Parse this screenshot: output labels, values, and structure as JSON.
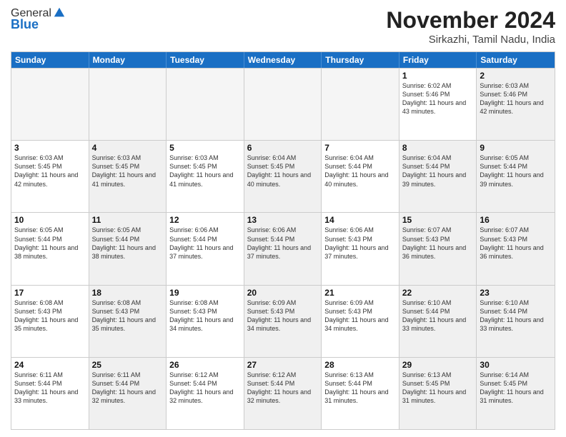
{
  "logo": {
    "general": "General",
    "blue": "Blue"
  },
  "title": "November 2024",
  "location": "Sirkazhi, Tamil Nadu, India",
  "header": {
    "days": [
      "Sunday",
      "Monday",
      "Tuesday",
      "Wednesday",
      "Thursday",
      "Friday",
      "Saturday"
    ]
  },
  "rows": [
    {
      "cells": [
        {
          "empty": true,
          "text": ""
        },
        {
          "empty": true,
          "text": ""
        },
        {
          "empty": true,
          "text": ""
        },
        {
          "empty": true,
          "text": ""
        },
        {
          "empty": true,
          "text": ""
        },
        {
          "day": "1",
          "info": "Sunrise: 6:02 AM\nSunset: 5:46 PM\nDaylight: 11 hours and 43 minutes."
        },
        {
          "day": "2",
          "shaded": true,
          "info": "Sunrise: 6:03 AM\nSunset: 5:46 PM\nDaylight: 11 hours and 42 minutes."
        }
      ]
    },
    {
      "cells": [
        {
          "day": "3",
          "info": "Sunrise: 6:03 AM\nSunset: 5:45 PM\nDaylight: 11 hours and 42 minutes."
        },
        {
          "day": "4",
          "shaded": true,
          "info": "Sunrise: 6:03 AM\nSunset: 5:45 PM\nDaylight: 11 hours and 41 minutes."
        },
        {
          "day": "5",
          "info": "Sunrise: 6:03 AM\nSunset: 5:45 PM\nDaylight: 11 hours and 41 minutes."
        },
        {
          "day": "6",
          "shaded": true,
          "info": "Sunrise: 6:04 AM\nSunset: 5:45 PM\nDaylight: 11 hours and 40 minutes."
        },
        {
          "day": "7",
          "info": "Sunrise: 6:04 AM\nSunset: 5:44 PM\nDaylight: 11 hours and 40 minutes."
        },
        {
          "day": "8",
          "shaded": true,
          "info": "Sunrise: 6:04 AM\nSunset: 5:44 PM\nDaylight: 11 hours and 39 minutes."
        },
        {
          "day": "9",
          "shaded": true,
          "info": "Sunrise: 6:05 AM\nSunset: 5:44 PM\nDaylight: 11 hours and 39 minutes."
        }
      ]
    },
    {
      "cells": [
        {
          "day": "10",
          "info": "Sunrise: 6:05 AM\nSunset: 5:44 PM\nDaylight: 11 hours and 38 minutes."
        },
        {
          "day": "11",
          "shaded": true,
          "info": "Sunrise: 6:05 AM\nSunset: 5:44 PM\nDaylight: 11 hours and 38 minutes."
        },
        {
          "day": "12",
          "info": "Sunrise: 6:06 AM\nSunset: 5:44 PM\nDaylight: 11 hours and 37 minutes."
        },
        {
          "day": "13",
          "shaded": true,
          "info": "Sunrise: 6:06 AM\nSunset: 5:44 PM\nDaylight: 11 hours and 37 minutes."
        },
        {
          "day": "14",
          "info": "Sunrise: 6:06 AM\nSunset: 5:43 PM\nDaylight: 11 hours and 37 minutes."
        },
        {
          "day": "15",
          "shaded": true,
          "info": "Sunrise: 6:07 AM\nSunset: 5:43 PM\nDaylight: 11 hours and 36 minutes."
        },
        {
          "day": "16",
          "shaded": true,
          "info": "Sunrise: 6:07 AM\nSunset: 5:43 PM\nDaylight: 11 hours and 36 minutes."
        }
      ]
    },
    {
      "cells": [
        {
          "day": "17",
          "info": "Sunrise: 6:08 AM\nSunset: 5:43 PM\nDaylight: 11 hours and 35 minutes."
        },
        {
          "day": "18",
          "shaded": true,
          "info": "Sunrise: 6:08 AM\nSunset: 5:43 PM\nDaylight: 11 hours and 35 minutes."
        },
        {
          "day": "19",
          "info": "Sunrise: 6:08 AM\nSunset: 5:43 PM\nDaylight: 11 hours and 34 minutes."
        },
        {
          "day": "20",
          "shaded": true,
          "info": "Sunrise: 6:09 AM\nSunset: 5:43 PM\nDaylight: 11 hours and 34 minutes."
        },
        {
          "day": "21",
          "info": "Sunrise: 6:09 AM\nSunset: 5:43 PM\nDaylight: 11 hours and 34 minutes."
        },
        {
          "day": "22",
          "shaded": true,
          "info": "Sunrise: 6:10 AM\nSunset: 5:44 PM\nDaylight: 11 hours and 33 minutes."
        },
        {
          "day": "23",
          "shaded": true,
          "info": "Sunrise: 6:10 AM\nSunset: 5:44 PM\nDaylight: 11 hours and 33 minutes."
        }
      ]
    },
    {
      "cells": [
        {
          "day": "24",
          "info": "Sunrise: 6:11 AM\nSunset: 5:44 PM\nDaylight: 11 hours and 33 minutes."
        },
        {
          "day": "25",
          "shaded": true,
          "info": "Sunrise: 6:11 AM\nSunset: 5:44 PM\nDaylight: 11 hours and 32 minutes."
        },
        {
          "day": "26",
          "info": "Sunrise: 6:12 AM\nSunset: 5:44 PM\nDaylight: 11 hours and 32 minutes."
        },
        {
          "day": "27",
          "shaded": true,
          "info": "Sunrise: 6:12 AM\nSunset: 5:44 PM\nDaylight: 11 hours and 32 minutes."
        },
        {
          "day": "28",
          "info": "Sunrise: 6:13 AM\nSunset: 5:44 PM\nDaylight: 11 hours and 31 minutes."
        },
        {
          "day": "29",
          "shaded": true,
          "info": "Sunrise: 6:13 AM\nSunset: 5:45 PM\nDaylight: 11 hours and 31 minutes."
        },
        {
          "day": "30",
          "shaded": true,
          "info": "Sunrise: 6:14 AM\nSunset: 5:45 PM\nDaylight: 11 hours and 31 minutes."
        }
      ]
    }
  ]
}
